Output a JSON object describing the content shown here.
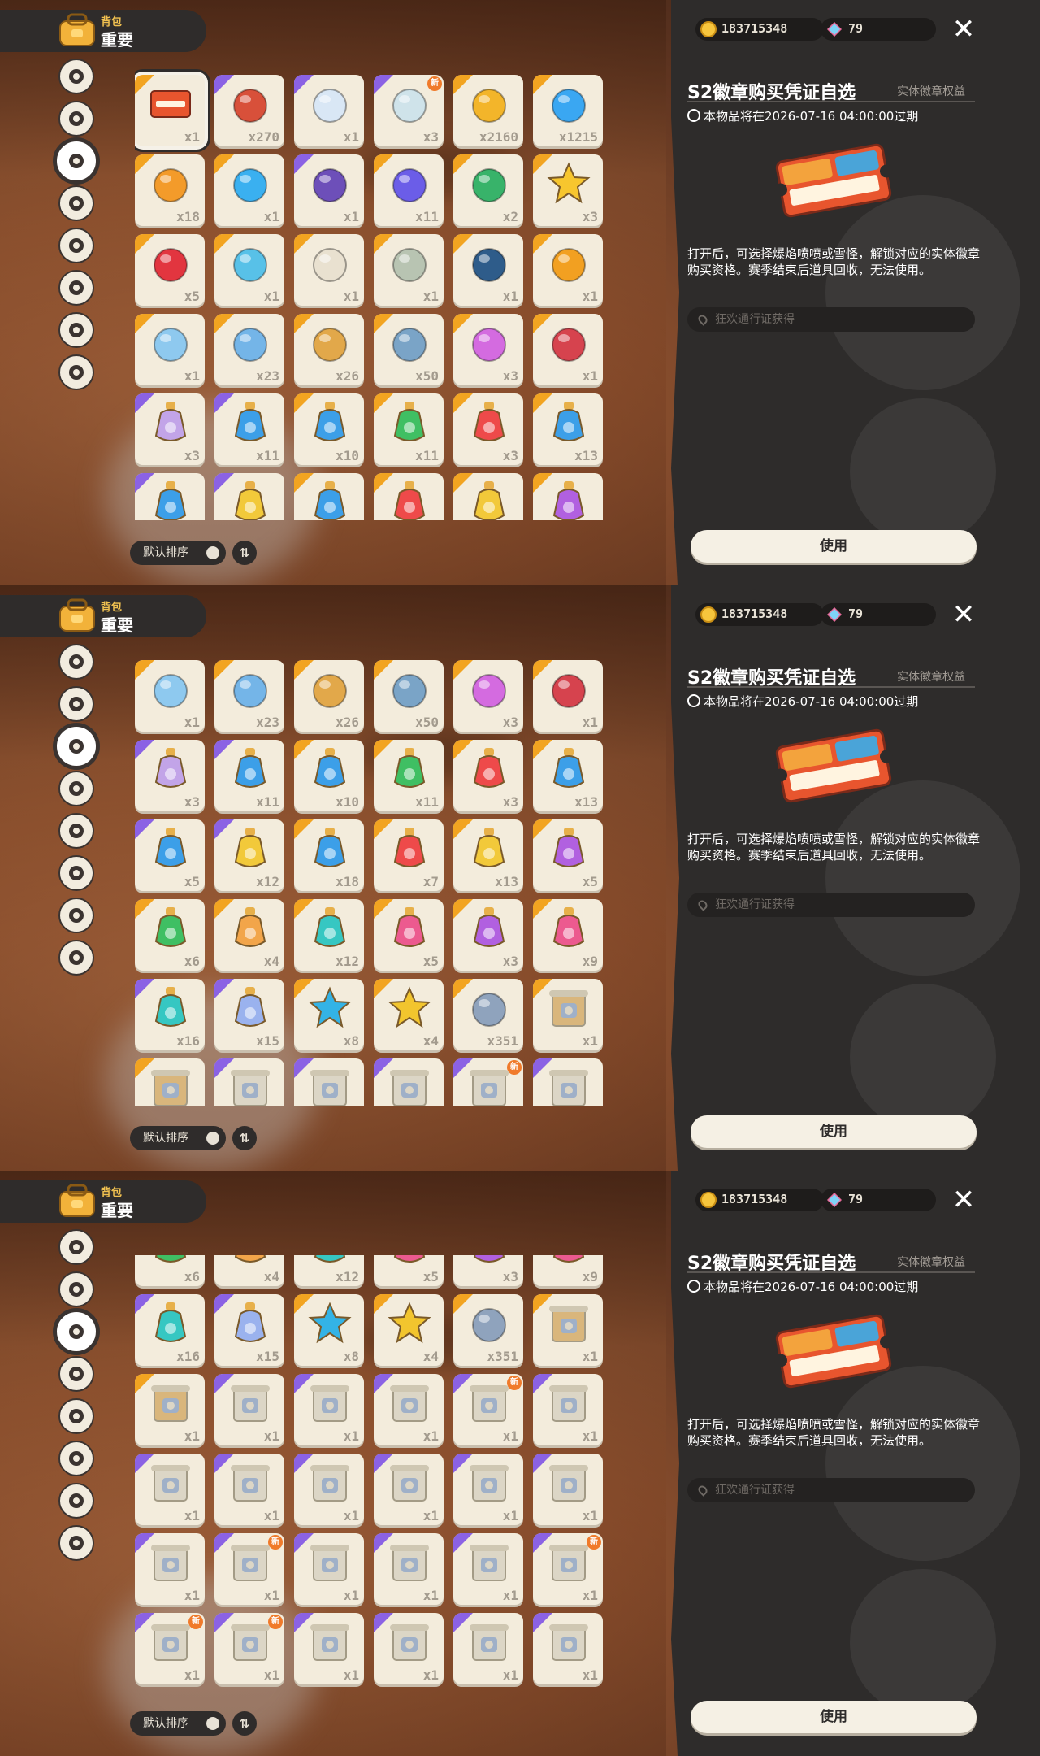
{
  "header": {
    "bag_label": "背包",
    "tab_label": "重要"
  },
  "categories": [
    "star-badge-icon",
    "leaf-icon",
    "spiky-ball-icon",
    "leaf-icon",
    "scroll-icon",
    "ball-icon",
    "acorn-icon",
    "sofa-icon"
  ],
  "sort": {
    "label": "默认排序",
    "toggle": "⇅"
  },
  "currency": {
    "coins": "183715348",
    "gems": "79",
    "close": "✕"
  },
  "detail": {
    "title": "S2徽章购买凭证自选",
    "tag": "实体徽章权益",
    "expiry": "本物品将在2026-07-16 04:00:00过期",
    "description": "打开后，可选择爆焰喷喷或雪怪，解锁对应的实体徽章购买资格。赛季结束后道具回收，无法使用。",
    "source": "狂欢通行证获得",
    "use_button": "使用"
  },
  "panels": [
    {
      "items": [
        [
          "ticket",
          "x1",
          "o",
          "sel"
        ],
        [
          "photo",
          "x270",
          "p",
          ""
        ],
        [
          "card",
          "x1",
          "p",
          ""
        ],
        [
          "paper",
          "x3",
          "p",
          "new"
        ],
        [
          "bell",
          "x2160",
          "o",
          ""
        ],
        [
          "crystal",
          "x1215",
          "o",
          ""
        ],
        [
          "orange-ball",
          "x18",
          "o",
          ""
        ],
        [
          "blue-flask",
          "x1",
          "o",
          ""
        ],
        [
          "pouch",
          "x1",
          "p",
          ""
        ],
        [
          "purple-crystal",
          "x11",
          "o",
          ""
        ],
        [
          "green-cap",
          "x2",
          "o",
          ""
        ],
        [
          "star",
          "x3",
          "o",
          ""
        ],
        [
          "red-gem",
          "x5",
          "o",
          ""
        ],
        [
          "blue-idol",
          "x1",
          "o",
          ""
        ],
        [
          "teapot",
          "x1",
          "o",
          ""
        ],
        [
          "crown",
          "x1",
          "o",
          ""
        ],
        [
          "planet",
          "x1",
          "o",
          ""
        ],
        [
          "sunflower",
          "x1",
          "o",
          ""
        ],
        [
          "mirror",
          "x1",
          "o",
          ""
        ],
        [
          "blue-stone",
          "x23",
          "o",
          ""
        ],
        [
          "gold-key",
          "x26",
          "o",
          ""
        ],
        [
          "magic-wand",
          "x50",
          "o",
          ""
        ],
        [
          "rainbow-potion",
          "x3",
          "o",
          ""
        ],
        [
          "red-wand",
          "x1",
          "o",
          ""
        ],
        [
          "star-bottle",
          "x3",
          "p",
          ""
        ],
        [
          "blue-bottle",
          "x11",
          "p",
          ""
        ],
        [
          "blue-bottle",
          "x10",
          "o",
          ""
        ],
        [
          "green-bottle",
          "x11",
          "o",
          ""
        ],
        [
          "red-bottle",
          "x3",
          "o",
          ""
        ],
        [
          "blue-bottle",
          "x13",
          "o",
          ""
        ],
        [
          "blue-bottle",
          "",
          "p",
          ""
        ],
        [
          "yellow-bottle",
          "",
          "p",
          ""
        ],
        [
          "blue-bottle",
          "",
          "o",
          ""
        ],
        [
          "red-bottle",
          "",
          "o",
          ""
        ],
        [
          "yellow-bottle",
          "",
          "o",
          ""
        ],
        [
          "purple-bottle",
          "",
          "o",
          ""
        ]
      ]
    },
    {
      "items": [
        [
          "mirror",
          "x1",
          "o",
          ""
        ],
        [
          "blue-stone",
          "x23",
          "o",
          ""
        ],
        [
          "gold-key",
          "x26",
          "o",
          ""
        ],
        [
          "magic-wand",
          "x50",
          "o",
          ""
        ],
        [
          "rainbow-potion",
          "x3",
          "o",
          ""
        ],
        [
          "red-wand",
          "x1",
          "o",
          ""
        ],
        [
          "star-bottle",
          "x3",
          "p",
          ""
        ],
        [
          "blue-bottle",
          "x11",
          "p",
          ""
        ],
        [
          "blue-bottle",
          "x10",
          "o",
          ""
        ],
        [
          "green-bottle",
          "x11",
          "o",
          ""
        ],
        [
          "red-bottle",
          "x3",
          "o",
          ""
        ],
        [
          "blue-bottle",
          "x13",
          "o",
          ""
        ],
        [
          "blue-bottle",
          "x5",
          "p",
          ""
        ],
        [
          "yellow-bottle",
          "x12",
          "p",
          ""
        ],
        [
          "blue-bottle",
          "x18",
          "o",
          ""
        ],
        [
          "red-bottle",
          "x7",
          "o",
          ""
        ],
        [
          "yellow-bottle",
          "x13",
          "o",
          ""
        ],
        [
          "purple-bottle",
          "x5",
          "o",
          ""
        ],
        [
          "green-bottle",
          "x6",
          "o",
          ""
        ],
        [
          "orange-bottle",
          "x4",
          "o",
          ""
        ],
        [
          "teal-bottle",
          "x12",
          "o",
          ""
        ],
        [
          "pink-bottle",
          "x5",
          "o",
          ""
        ],
        [
          "purple-bottle",
          "x3",
          "o",
          ""
        ],
        [
          "pink-bottle",
          "x9",
          "o",
          ""
        ],
        [
          "teal-bottle",
          "x16",
          "p",
          ""
        ],
        [
          "swirl-bottle",
          "x15",
          "p",
          ""
        ],
        [
          "blue-star",
          "x8",
          "o",
          ""
        ],
        [
          "gold-star",
          "x4",
          "o",
          ""
        ],
        [
          "coin-token",
          "x351",
          "o",
          ""
        ],
        [
          "map",
          "x1",
          "o",
          ""
        ],
        [
          "map",
          "",
          "o",
          ""
        ],
        [
          "scroll",
          "",
          "p",
          ""
        ],
        [
          "scroll",
          "",
          "p",
          ""
        ],
        [
          "scroll",
          "",
          "p",
          ""
        ],
        [
          "scroll",
          "",
          "p",
          "new"
        ],
        [
          "scroll",
          "",
          "p",
          ""
        ]
      ]
    },
    {
      "items": [
        [
          "green-bottle",
          "x6",
          "o",
          ""
        ],
        [
          "orange-bottle",
          "x4",
          "o",
          ""
        ],
        [
          "teal-bottle",
          "x12",
          "o",
          ""
        ],
        [
          "pink-bottle",
          "x5",
          "o",
          ""
        ],
        [
          "purple-bottle",
          "x3",
          "o",
          ""
        ],
        [
          "pink-bottle",
          "x9",
          "o",
          ""
        ],
        [
          "teal-bottle",
          "x16",
          "p",
          ""
        ],
        [
          "swirl-bottle",
          "x15",
          "p",
          ""
        ],
        [
          "blue-star",
          "x8",
          "o",
          ""
        ],
        [
          "gold-star",
          "x4",
          "o",
          ""
        ],
        [
          "coin-token",
          "x351",
          "o",
          ""
        ],
        [
          "map",
          "x1",
          "o",
          ""
        ],
        [
          "map",
          "x1",
          "o",
          ""
        ],
        [
          "scroll",
          "x1",
          "p",
          ""
        ],
        [
          "scroll",
          "x1",
          "p",
          ""
        ],
        [
          "scroll",
          "x1",
          "p",
          ""
        ],
        [
          "scroll",
          "x1",
          "p",
          "new"
        ],
        [
          "scroll",
          "x1",
          "p",
          ""
        ],
        [
          "scroll",
          "x1",
          "p",
          ""
        ],
        [
          "scroll",
          "x1",
          "p",
          ""
        ],
        [
          "scroll",
          "x1",
          "p",
          ""
        ],
        [
          "scroll",
          "x1",
          "p",
          ""
        ],
        [
          "scroll",
          "x1",
          "p",
          ""
        ],
        [
          "scroll",
          "x1",
          "p",
          ""
        ],
        [
          "scroll",
          "x1",
          "p",
          ""
        ],
        [
          "scroll",
          "x1",
          "p",
          "new"
        ],
        [
          "scroll",
          "x1",
          "p",
          ""
        ],
        [
          "scroll",
          "x1",
          "p",
          ""
        ],
        [
          "scroll",
          "x1",
          "p",
          ""
        ],
        [
          "scroll",
          "x1",
          "p",
          "new"
        ],
        [
          "scroll",
          "x1",
          "p",
          "new"
        ],
        [
          "scroll",
          "x1",
          "p",
          "new"
        ],
        [
          "scroll",
          "x1",
          "p",
          ""
        ],
        [
          "scroll",
          "x1",
          "p",
          ""
        ],
        [
          "scroll",
          "x1",
          "p",
          ""
        ],
        [
          "scroll",
          "x1",
          "p",
          ""
        ]
      ]
    }
  ],
  "colors": {
    "orange_tag": "#f2a421",
    "purple_tag": "#8b62e4",
    "panel_dark": "#2e2c2b"
  }
}
